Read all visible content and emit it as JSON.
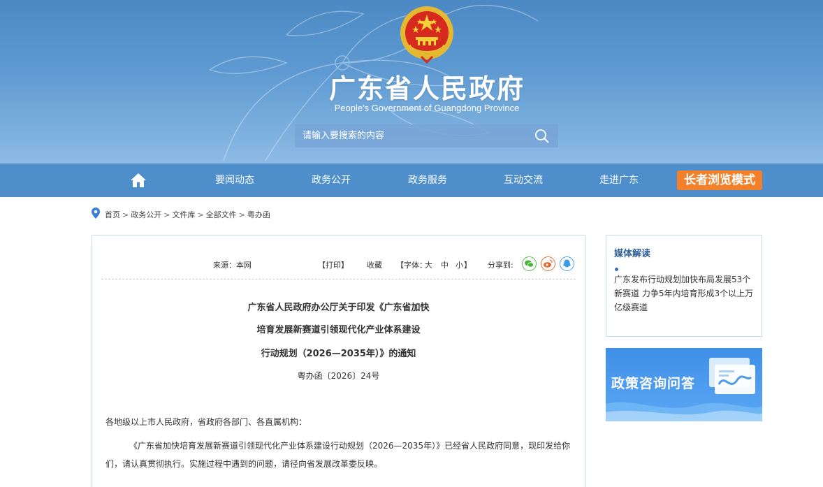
{
  "header": {
    "title": "广东省人民政府",
    "subtitle": "People's Government of Guangdong Province",
    "search_placeholder": "请输入要搜索的内容"
  },
  "nav": {
    "items": [
      "要闻动态",
      "政务公开",
      "政务服务",
      "互动交流",
      "走进广东"
    ],
    "elder_mode": "长者浏览模式"
  },
  "breadcrumb": [
    "首页",
    "政务公开",
    "文件库",
    "全部文件",
    "粤办函"
  ],
  "article": {
    "source": "来源：本网",
    "print": "【打印】",
    "favorite": "收藏",
    "font_label": "【字体：",
    "font_large": "大",
    "font_medium": "中",
    "font_small": "小",
    "font_close": "】",
    "share_label": "分享到:",
    "title_lines": [
      "广东省人民政府办公厅关于印发《广东省加快",
      "培育发展新赛道引领现代化产业体系建设",
      "行动规划（2026—2035年）》的通知"
    ],
    "doc_number": "粤办函〔2026〕24号",
    "salutation": "各地级以上市人民政府，省政府各部门、各直属机构：",
    "body": "《广东省加快培育发展新赛道引领现代化产业体系建设行动规划（2026—2035年）》已经省人民政府同意，现印发给你们，请认真贯彻执行。实施过程中遇到的问题，请径向省发展改革委反映。"
  },
  "sidebar": {
    "media_heading": "媒体解读",
    "media_link": "广东发布行动规划加快布局发展53个新赛道 力争5年内培育形成3个以上万亿级赛道",
    "policy_banner": "政策咨询问答"
  },
  "colors": {
    "nav_bg": "#4e8ecb",
    "elder_button": "#f4812a",
    "heading_blue": "#2f5e96"
  }
}
